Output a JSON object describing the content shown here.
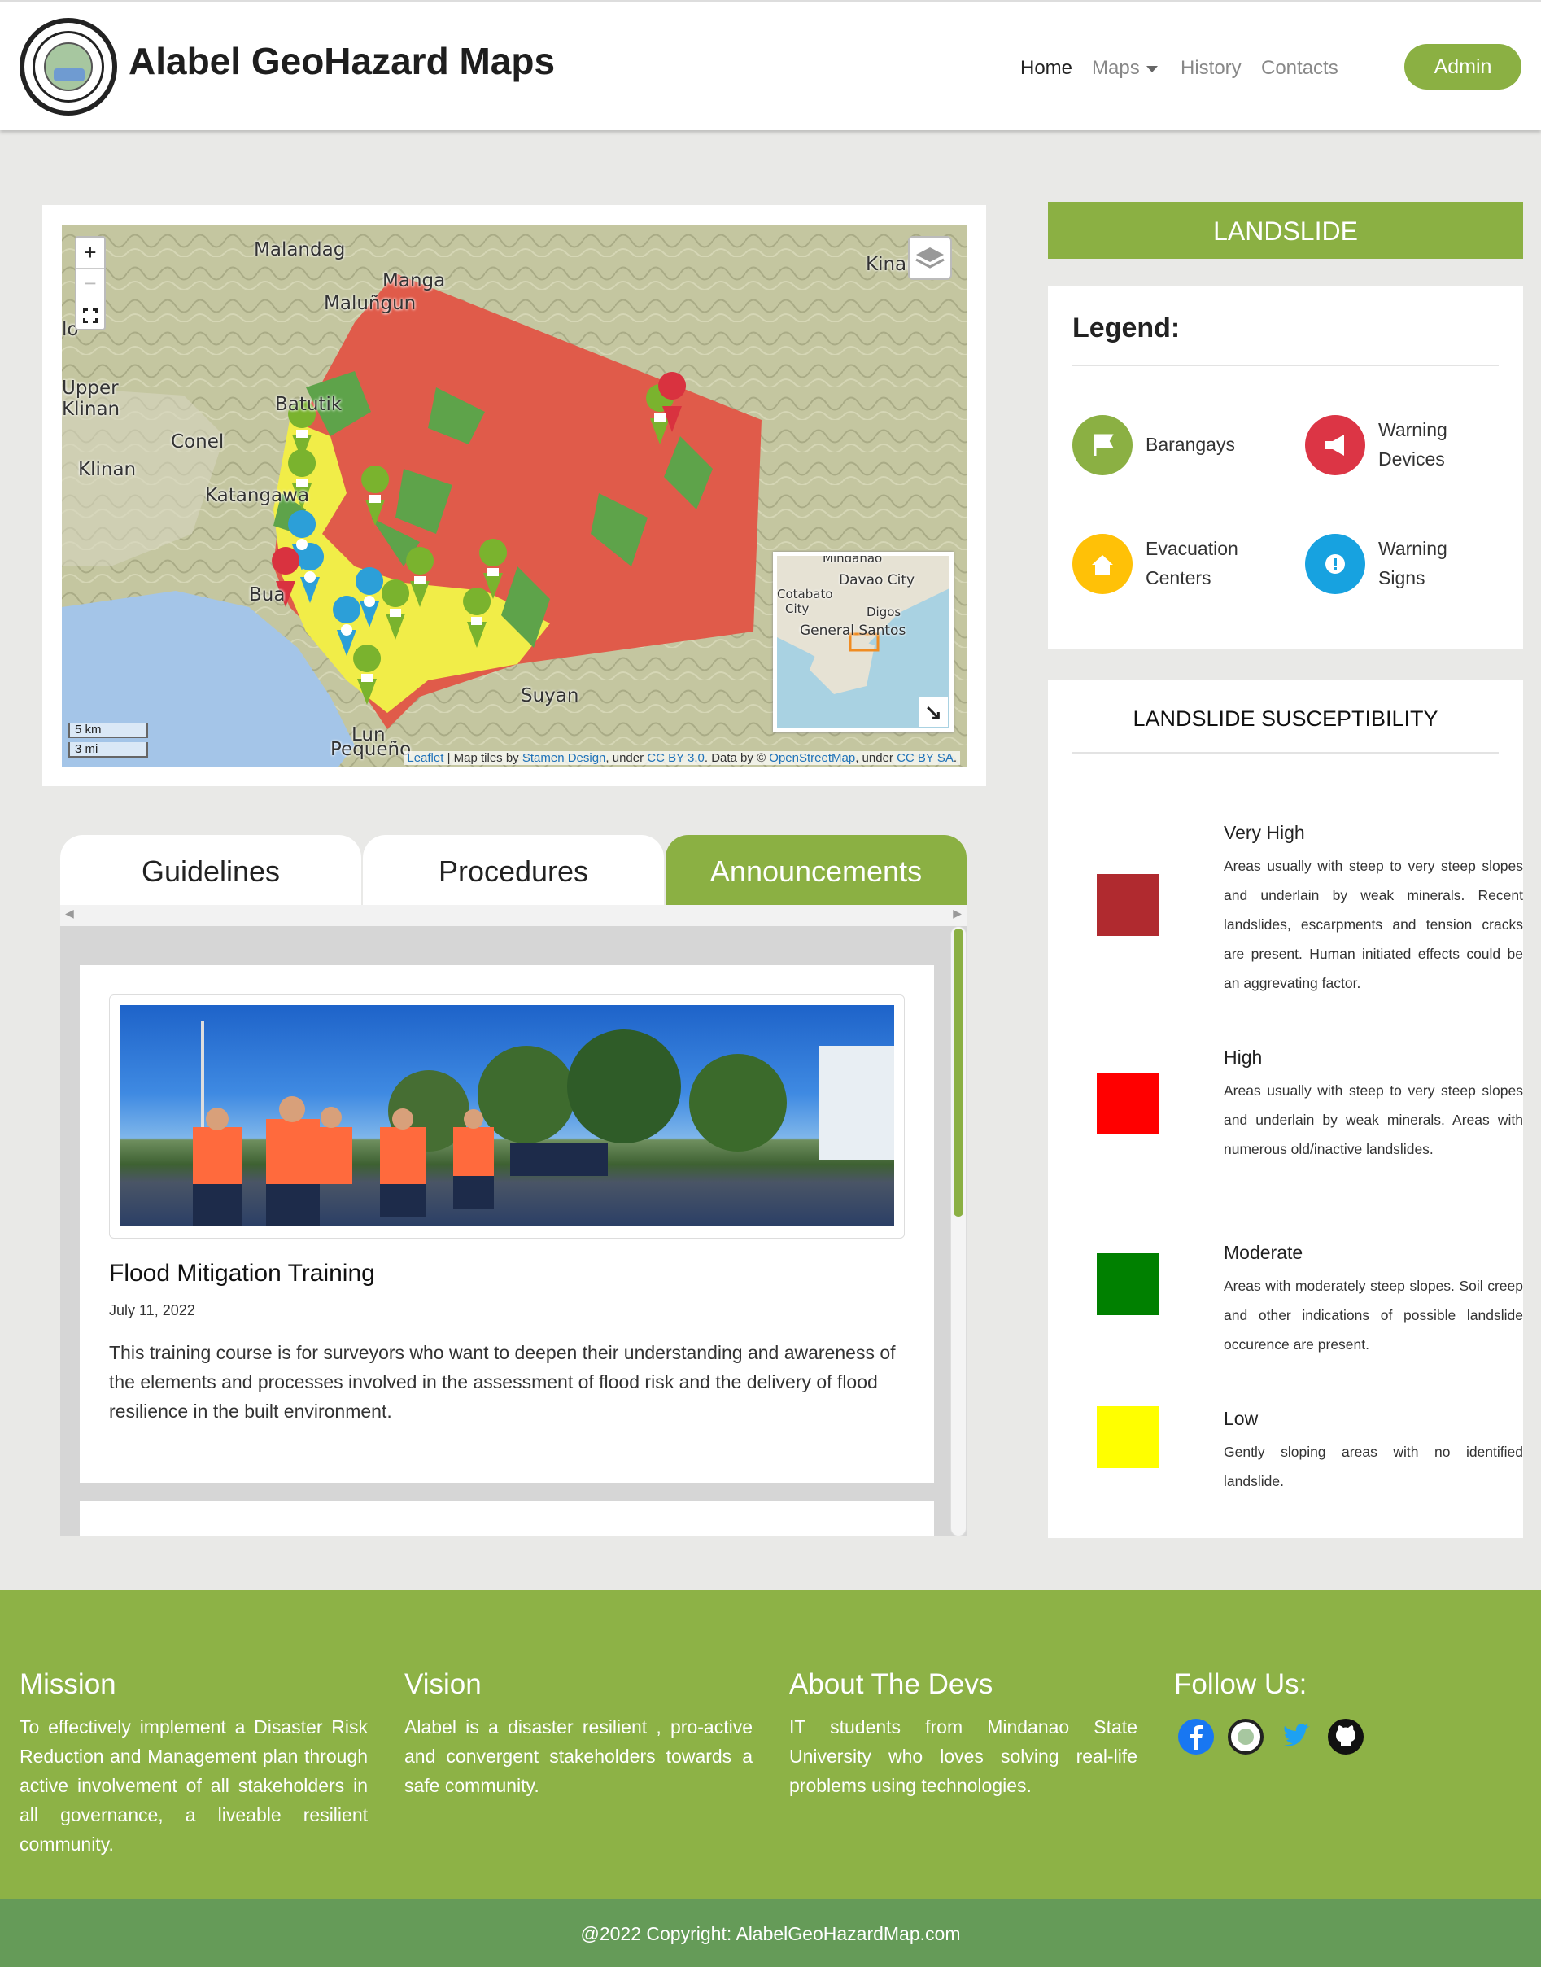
{
  "navbar": {
    "brand": "Alabel GeoHazard Maps",
    "links": [
      {
        "label": "Home"
      },
      {
        "label": "Maps"
      },
      {
        "label": "History"
      },
      {
        "label": "Contacts"
      }
    ],
    "admin_label": "Admin"
  },
  "map": {
    "zoom_in": "+",
    "zoom_out": "−",
    "places": [
      "Malandag",
      "Manga",
      "Maluñgun",
      "Kinan",
      "lo",
      "Upper",
      "Klinan",
      "Batutik",
      "Conel",
      "Klinan",
      "Katangawa",
      "Bua",
      "Suyan",
      "Lun",
      "Pequeño"
    ],
    "minimap_places": [
      "Mindanao",
      "Davao City",
      "Cotabato",
      "City",
      "Digos",
      "General Santos"
    ],
    "scale": [
      "5 km",
      "3 mi"
    ],
    "attribution": {
      "leaflet": "Leaflet",
      "sep1": " | Map tiles by ",
      "stamen": "Stamen Design",
      "sep2": ", under ",
      "cc1": "CC BY 3.0",
      "sep3": ". Data by © ",
      "osm": "OpenStreetMap",
      "sep4": ", under ",
      "cc2": "CC BY SA",
      "end": "."
    },
    "colors": {
      "very_high": "#e05b4a",
      "low": "#f1ed48",
      "moderate": "#5ea34a",
      "marker_green": "#7ab32e",
      "marker_blue": "#2c9fd8",
      "marker_red": "#d9323f"
    }
  },
  "tabs": [
    {
      "label": "Guidelines"
    },
    {
      "label": "Procedures"
    },
    {
      "label": "Announcements"
    }
  ],
  "announcement": {
    "title": "Flood Mitigation Training",
    "date": "July 11, 2022",
    "body": "This training course is for surveyors who want to deepen their understanding and awareness of the elements and processes involved in the assessment of flood risk and the delivery of flood resilience in the built environment."
  },
  "sidebar": {
    "header": "LANDSLIDE",
    "legend_title": "Legend:",
    "legend": [
      {
        "label": "Barangays",
        "color": "#8bb043",
        "icon": "flag-icon"
      },
      {
        "label": "Warning Devices",
        "color": "#dc3545",
        "icon": "megaphone-icon"
      },
      {
        "label": "Evacuation Centers",
        "color": "#ffc107",
        "icon": "house-icon"
      },
      {
        "label": "Warning Signs",
        "color": "#17a2e0",
        "icon": "exclamation-icon"
      }
    ],
    "susceptibility_title": "LANDSLIDE SUSCEPTIBILITY",
    "susceptibility": [
      {
        "name": "Very High",
        "color": "#b02a2f",
        "desc": "Areas usually with steep to very steep slopes and underlain by weak minerals. Recent landslides, escarpments and tension cracks are present. Human initiated effects could be an aggrevating factor."
      },
      {
        "name": "High",
        "color": "#ff0000",
        "desc": "Areas usually with steep to very steep slopes and underlain by weak minerals. Areas with numerous old/inactive landslides."
      },
      {
        "name": "Moderate",
        "color": "#008000",
        "desc": "Areas with moderately steep slopes. Soil creep and other indications of possible landslide occurence are present."
      },
      {
        "name": "Low",
        "color": "#ffff00",
        "desc": "Gently sloping areas with no identified landslide."
      }
    ]
  },
  "footer": {
    "mission_title": "Mission",
    "mission": "To effectively implement a Disaster Risk Reduction and Management plan through active involvement of all stakeholders in all governance, a liveable resilient community.",
    "vision_title": "Vision",
    "vision": "Alabel is a disaster resilient , pro-active and convergent stakeholders towards a safe community.",
    "devs_title": "About The Devs",
    "devs": "IT students from Mindanao State University who loves solving real-life problems using technologies.",
    "follow_title": "Follow Us:",
    "social": [
      "facebook-icon",
      "alabel-seal-icon",
      "twitter-icon",
      "github-icon"
    ],
    "copyright": "@2022 Copyright: AlabelGeoHazardMap.com"
  }
}
